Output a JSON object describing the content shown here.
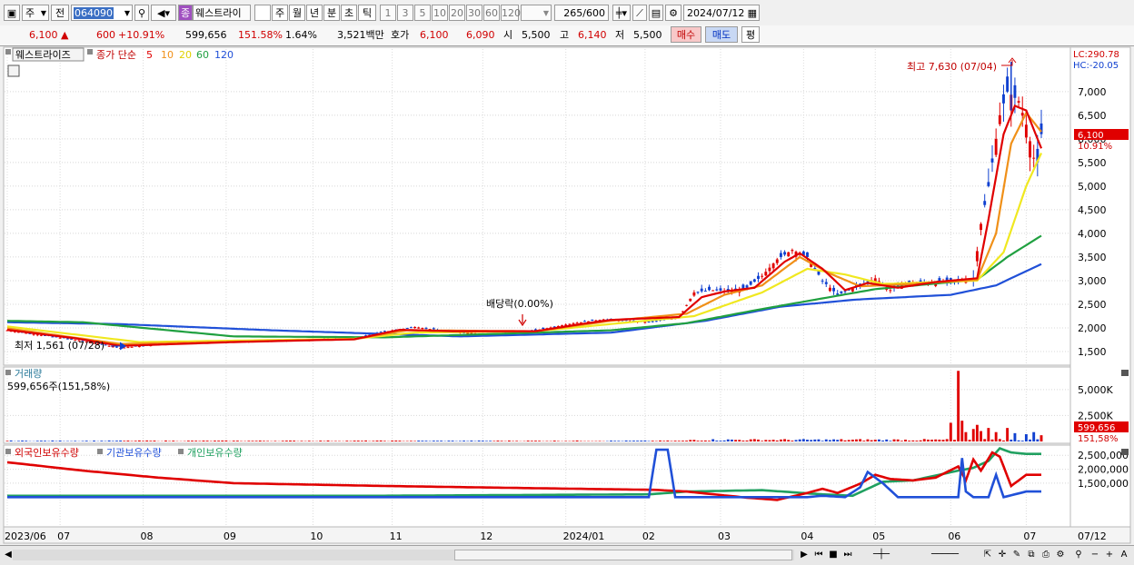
{
  "toolbar": {
    "market_type": "주",
    "prev_label": "전",
    "stock_code": "064090",
    "stock_badge": "종",
    "stock_name": "웨스트라이",
    "periods": [
      "일",
      "주",
      "월",
      "년",
      "분",
      "초",
      "틱"
    ],
    "active_period": "일",
    "intervals": [
      "1",
      "3",
      "5",
      "10",
      "20",
      "30",
      "60",
      "120"
    ],
    "count": "265",
    "count_total": "/600",
    "date": "2024/07/12"
  },
  "quote": {
    "price": "6,100",
    "change": "600",
    "change_pct": "+10.91%",
    "volume": "599,656",
    "volume_ratio": "151.58%",
    "turnover": "1.64%",
    "amount": "3,521백만",
    "bid_label": "호가",
    "bid1": "6,100",
    "bid2": "6,090",
    "open_label": "시",
    "open": "5,500",
    "high_label": "고",
    "high": "6,140",
    "low_label": "저",
    "low": "5,500",
    "buy_label": "매수",
    "sell_label": "매도",
    "avg_label": "평"
  },
  "colors": {
    "up": "#e00000",
    "down": "#1040d0",
    "ma5": "#e00000",
    "ma10": "#f09018",
    "ma20": "#f0e820",
    "ma60": "#20a040",
    "ma120": "#2050d8",
    "foreign": "#e00000",
    "institution": "#2050d8",
    "individual": "#20a060"
  },
  "chart_data": [
    {
      "type": "candlestick",
      "title": "웨스트라이즈",
      "legend": {
        "label": "종가 단순",
        "periods": [
          "5",
          "10",
          "20",
          "60",
          "120"
        ]
      },
      "y_ticks": [
        "7,000",
        "6,500",
        "6,000",
        "5,500",
        "5,000",
        "4,500",
        "4,000",
        "3,500",
        "3,000",
        "2,500",
        "2,000",
        "1,500"
      ],
      "ylim": [
        1250,
        7900
      ],
      "lc": "LC:290.78",
      "hc": "HC:-20.05",
      "current_price_label": "6,100",
      "current_change_label": "10.91%",
      "annotations": {
        "high": "최고 7,630 (07/04)",
        "low": "최저 1,561 (07/28)",
        "dividend": "배당락(0.00%)"
      },
      "x_ticks": [
        "2023/06",
        "07",
        "08",
        "09",
        "10",
        "11",
        "12",
        "2024/01",
        "02",
        "03",
        "04",
        "05",
        "06",
        "07"
      ],
      "x_right_label": "07/12",
      "close_keypoints": [
        [
          0,
          1950
        ],
        [
          18,
          1750
        ],
        [
          30,
          1580
        ],
        [
          45,
          1680
        ],
        [
          70,
          1720
        ],
        [
          92,
          1780
        ],
        [
          100,
          1920
        ],
        [
          108,
          2020
        ],
        [
          118,
          1920
        ],
        [
          128,
          1860
        ],
        [
          138,
          1920
        ],
        [
          150,
          2100
        ],
        [
          158,
          2180
        ],
        [
          170,
          2120
        ],
        [
          178,
          2220
        ],
        [
          182,
          2750
        ],
        [
          186,
          2800
        ],
        [
          192,
          2780
        ],
        [
          196,
          2850
        ],
        [
          200,
          3100
        ],
        [
          204,
          3450
        ],
        [
          208,
          3650
        ],
        [
          212,
          3500
        ],
        [
          216,
          3000
        ],
        [
          220,
          2700
        ],
        [
          226,
          2900
        ],
        [
          230,
          3050
        ],
        [
          234,
          2800
        ],
        [
          238,
          2950
        ],
        [
          250,
          2980
        ],
        [
          256,
          3050
        ],
        [
          258,
          4200
        ],
        [
          260,
          5000
        ],
        [
          263,
          6500
        ],
        [
          265,
          7000
        ],
        [
          268,
          6800
        ],
        [
          270,
          6300
        ],
        [
          272,
          5600
        ],
        [
          273,
          5500
        ],
        [
          274,
          6100
        ]
      ],
      "ma_keypoints": {
        "5": [
          [
            0,
            1960
          ],
          [
            18,
            1780
          ],
          [
            30,
            1620
          ],
          [
            60,
            1700
          ],
          [
            92,
            1760
          ],
          [
            104,
            1960
          ],
          [
            118,
            1930
          ],
          [
            140,
            1930
          ],
          [
            152,
            2080
          ],
          [
            160,
            2170
          ],
          [
            178,
            2230
          ],
          [
            184,
            2650
          ],
          [
            190,
            2770
          ],
          [
            198,
            2850
          ],
          [
            206,
            3400
          ],
          [
            210,
            3580
          ],
          [
            216,
            3250
          ],
          [
            222,
            2800
          ],
          [
            228,
            2950
          ],
          [
            236,
            2850
          ],
          [
            246,
            2970
          ],
          [
            257,
            3050
          ],
          [
            260,
            4300
          ],
          [
            264,
            6100
          ],
          [
            267,
            6700
          ],
          [
            270,
            6600
          ],
          [
            274,
            5800
          ]
        ],
        "10": [
          [
            0,
            1990
          ],
          [
            30,
            1660
          ],
          [
            92,
            1760
          ],
          [
            106,
            1950
          ],
          [
            140,
            1930
          ],
          [
            160,
            2150
          ],
          [
            180,
            2300
          ],
          [
            190,
            2700
          ],
          [
            200,
            2900
          ],
          [
            210,
            3500
          ],
          [
            218,
            3150
          ],
          [
            226,
            2880
          ],
          [
            240,
            2930
          ],
          [
            257,
            3020
          ],
          [
            262,
            4000
          ],
          [
            266,
            5900
          ],
          [
            270,
            6550
          ],
          [
            274,
            6150
          ]
        ],
        "20": [
          [
            0,
            2030
          ],
          [
            35,
            1700
          ],
          [
            92,
            1770
          ],
          [
            108,
            1900
          ],
          [
            140,
            1930
          ],
          [
            165,
            2120
          ],
          [
            182,
            2250
          ],
          [
            200,
            2750
          ],
          [
            212,
            3250
          ],
          [
            222,
            3130
          ],
          [
            232,
            2930
          ],
          [
            257,
            3000
          ],
          [
            264,
            3600
          ],
          [
            270,
            5000
          ],
          [
            274,
            5700
          ]
        ],
        "60": [
          [
            0,
            2150
          ],
          [
            20,
            2120
          ],
          [
            60,
            1820
          ],
          [
            100,
            1800
          ],
          [
            160,
            1950
          ],
          [
            180,
            2100
          ],
          [
            200,
            2400
          ],
          [
            230,
            2820
          ],
          [
            257,
            3020
          ],
          [
            265,
            3500
          ],
          [
            274,
            3950
          ]
        ],
        "120": [
          [
            0,
            2120
          ],
          [
            30,
            2080
          ],
          [
            70,
            1950
          ],
          [
            120,
            1820
          ],
          [
            160,
            1900
          ],
          [
            185,
            2150
          ],
          [
            205,
            2450
          ],
          [
            225,
            2600
          ],
          [
            250,
            2700
          ],
          [
            262,
            2900
          ],
          [
            274,
            3350
          ]
        ]
      }
    },
    {
      "type": "bar",
      "title": "거래량",
      "subtitle": "599,656주(151,58%)",
      "y_ticks": [
        "5,000K",
        "2,500K"
      ],
      "ylim": [
        0,
        7000000
      ],
      "current_value_label": "599,656",
      "current_ratio_label": "151,58%",
      "spike_values": [
        [
          250,
          1800000
        ],
        [
          252,
          6800000
        ],
        [
          253,
          2000000
        ],
        [
          254,
          900000
        ],
        [
          256,
          1200000
        ],
        [
          257,
          1600000
        ],
        [
          258,
          1000000
        ],
        [
          260,
          1300000
        ],
        [
          262,
          900000
        ],
        [
          265,
          1300000
        ],
        [
          267,
          800000
        ],
        [
          270,
          700000
        ],
        [
          272,
          900000
        ],
        [
          274,
          599656
        ]
      ]
    },
    {
      "type": "line",
      "series_labels": [
        "외국인보유수량",
        "기관보유수량",
        "개인보유수량"
      ],
      "y_ticks": [
        "2,500,000",
        "2,000,000",
        "1,500,000"
      ],
      "ylim": [
        0,
        2800000
      ],
      "foreign_keypoints": [
        [
          0,
          2250000
        ],
        [
          20,
          1950000
        ],
        [
          40,
          1700000
        ],
        [
          60,
          1500000
        ],
        [
          100,
          1400000
        ],
        [
          140,
          1320000
        ],
        [
          172,
          1260000
        ],
        [
          180,
          1200000
        ],
        [
          196,
          980000
        ],
        [
          204,
          900000
        ],
        [
          212,
          1150000
        ],
        [
          216,
          1300000
        ],
        [
          220,
          1150000
        ],
        [
          226,
          1480000
        ],
        [
          230,
          1800000
        ],
        [
          234,
          1650000
        ],
        [
          240,
          1600000
        ],
        [
          246,
          1700000
        ],
        [
          252,
          2100000
        ],
        [
          254,
          1600000
        ],
        [
          256,
          2350000
        ],
        [
          258,
          1950000
        ],
        [
          261,
          2600000
        ],
        [
          263,
          2450000
        ],
        [
          266,
          1400000
        ],
        [
          270,
          1800000
        ]
      ],
      "institution_keypoints": [
        [
          0,
          1000000
        ],
        [
          170,
          1000000
        ],
        [
          172,
          2700000
        ],
        [
          175,
          2700000
        ],
        [
          177,
          1000000
        ],
        [
          212,
          1000000
        ],
        [
          216,
          1050000
        ],
        [
          222,
          1000000
        ],
        [
          226,
          1350000
        ],
        [
          228,
          1900000
        ],
        [
          232,
          1500000
        ],
        [
          236,
          1000000
        ],
        [
          252,
          1000000
        ],
        [
          253,
          2400000
        ],
        [
          254,
          1200000
        ],
        [
          256,
          1000000
        ],
        [
          260,
          1000000
        ],
        [
          262,
          1800000
        ],
        [
          264,
          1000000
        ],
        [
          270,
          1200000
        ]
      ],
      "individual_keypoints": [
        [
          0,
          1050000
        ],
        [
          100,
          1050000
        ],
        [
          170,
          1100000
        ],
        [
          180,
          1200000
        ],
        [
          200,
          1250000
        ],
        [
          216,
          1100000
        ],
        [
          224,
          1050000
        ],
        [
          232,
          1550000
        ],
        [
          240,
          1600000
        ],
        [
          252,
          1950000
        ],
        [
          256,
          2050000
        ],
        [
          260,
          2300000
        ],
        [
          263,
          2750000
        ],
        [
          266,
          2600000
        ],
        [
          270,
          2550000
        ]
      ]
    }
  ]
}
